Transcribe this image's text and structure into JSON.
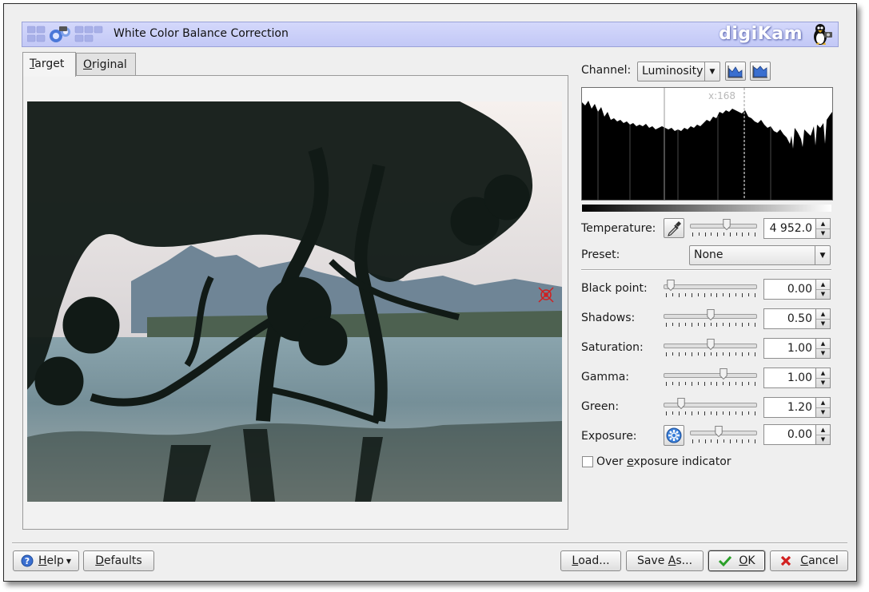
{
  "window": {
    "title": "White Color Balance Correction",
    "brand": "digiKam"
  },
  "tabs": [
    {
      "label": "Target",
      "u": "T",
      "rest": "arget"
    },
    {
      "label": "Original",
      "u": "O",
      "rest": "riginal"
    }
  ],
  "channel": {
    "label": "Channel:",
    "value": "Luminosity"
  },
  "histogram": {
    "marker_text": "x:168"
  },
  "temperature": {
    "label": "Temperature:",
    "value": "4 952.0",
    "slider_fraction": 0.55
  },
  "preset": {
    "label": "Preset:",
    "value": "None"
  },
  "controls": [
    {
      "label": "Black point:",
      "value": "0.00",
      "slider_fraction": 0.04
    },
    {
      "label": "Shadows:",
      "value": "0.50",
      "slider_fraction": 0.5
    },
    {
      "label": "Saturation:",
      "value": "1.00",
      "slider_fraction": 0.5
    },
    {
      "label": "Gamma:",
      "value": "1.00",
      "slider_fraction": 0.65
    },
    {
      "label": "Green:",
      "value": "1.20",
      "slider_fraction": 0.16
    }
  ],
  "exposure": {
    "label": "Exposure:",
    "value": "0.00",
    "slider_fraction": 0.42
  },
  "overexposure": {
    "label": "Over exposure indicator",
    "pre": "Over ",
    "u": "e",
    "post": "xposure indicator",
    "checked": false
  },
  "buttons": {
    "help": {
      "u": "H",
      "rest": "elp"
    },
    "defaults": {
      "u": "D",
      "rest": "efaults"
    },
    "load": {
      "u": "L",
      "rest": "oad..."
    },
    "save_as": {
      "pre": "Save ",
      "u": "A",
      "rest": "s..."
    },
    "ok": {
      "u": "O",
      "rest": "K"
    },
    "cancel": {
      "u": "C",
      "rest": "ancel"
    }
  },
  "colors": {
    "titlebar": "#c8cdf8",
    "accent": "#3a6fd0"
  }
}
